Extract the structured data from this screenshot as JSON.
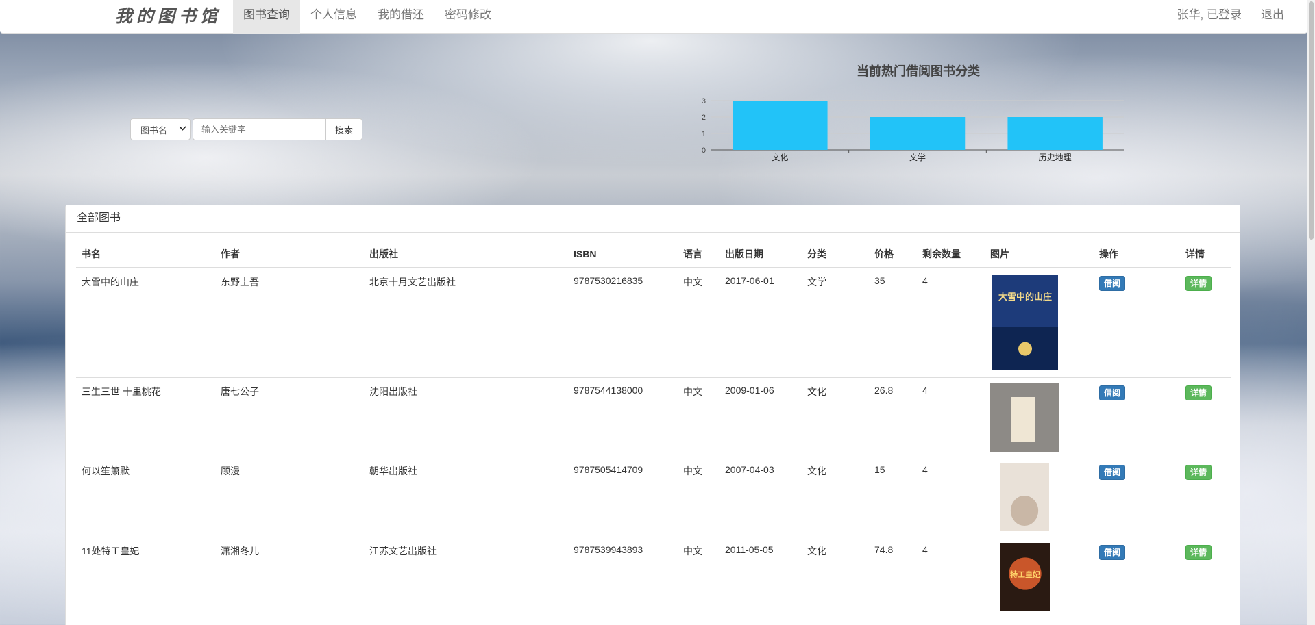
{
  "brand": "我的图书馆",
  "nav": {
    "items": [
      "图书查询",
      "个人信息",
      "我的借还",
      "密码修改"
    ],
    "active": "图书查询",
    "user_status": "张华, 已登录",
    "logout": "退出"
  },
  "search": {
    "select_value": "图书名",
    "placeholder": "输入关键字",
    "button": "搜索"
  },
  "chart_data": {
    "type": "bar",
    "title": "当前热门借阅图书分类",
    "categories": [
      "文化",
      "文学",
      "历史地理"
    ],
    "values": [
      3,
      2,
      2
    ],
    "ylim": [
      0,
      3
    ],
    "yticks": [
      "0",
      "1",
      "2",
      "3"
    ],
    "color": "#22c3f8",
    "grid": true
  },
  "panel": {
    "title": "全部图书",
    "columns": [
      "书名",
      "作者",
      "出版社",
      "ISBN",
      "语言",
      "出版日期",
      "分类",
      "价格",
      "剩余数量",
      "图片",
      "操作",
      "详情"
    ],
    "borrow_label": "借阅",
    "detail_label": "详情",
    "rows": [
      {
        "title": "大雪中的山庄",
        "author": "东野圭吾",
        "publisher": "北京十月文艺出版社",
        "isbn": "9787530216835",
        "language": "中文",
        "date": "2017-06-01",
        "category": "文学",
        "price": "35",
        "stock": "4",
        "cover_text": "大雪中的山庄",
        "cover_color": "#1d3b7a"
      },
      {
        "title": "三生三世 十里桃花",
        "author": "唐七公子",
        "publisher": "沈阳出版社",
        "isbn": "9787544138000",
        "language": "中文",
        "date": "2009-01-06",
        "category": "文化",
        "price": "26.8",
        "stock": "4",
        "cover_text": "",
        "cover_color": "#8d8a86"
      },
      {
        "title": "何以笙箫默",
        "author": "顾漫",
        "publisher": "朝华出版社",
        "isbn": "9787505414709",
        "language": "中文",
        "date": "2007-04-03",
        "category": "文化",
        "price": "15",
        "stock": "4",
        "cover_text": "",
        "cover_color": "#e9e1d8"
      },
      {
        "title": "11处特工皇妃",
        "author": "潇湘冬儿",
        "publisher": "江苏文艺出版社",
        "isbn": "9787539943893",
        "language": "中文",
        "date": "2011-05-05",
        "category": "文化",
        "price": "74.8",
        "stock": "4",
        "cover_text": "特工皇妃",
        "cover_color": "#2a1a12"
      }
    ]
  }
}
